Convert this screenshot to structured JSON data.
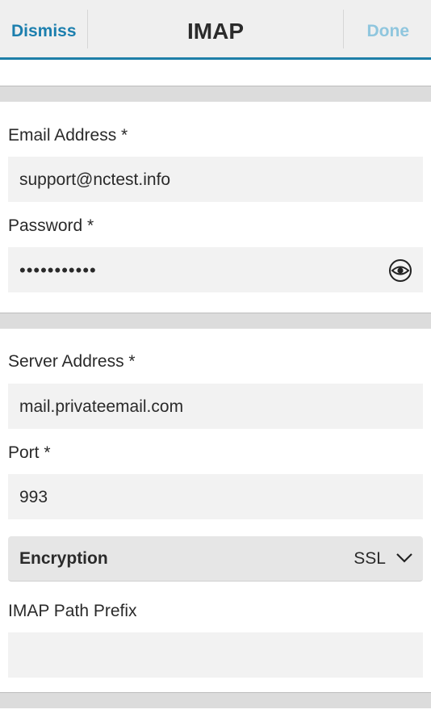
{
  "titlebar": {
    "dismiss_label": "Dismiss",
    "title": "IMAP",
    "done_label": "Done"
  },
  "account": {
    "email_label": "Email Address *",
    "email_value": "support@nctest.info",
    "password_label": "Password *",
    "password_value": "•••••••••••",
    "show_password_icon": "eye-icon"
  },
  "server": {
    "server_address_label": "Server Address *",
    "server_address_value": "mail.privateemail.com",
    "port_label": "Port *",
    "port_value": "993",
    "encryption_label": "Encryption",
    "encryption_value": "SSL",
    "encryption_icon": "chevron-down-icon",
    "path_prefix_label": "IMAP Path Prefix",
    "path_prefix_value": ""
  },
  "colors": {
    "accent": "#1c7fae",
    "done_disabled": "#8fc6de",
    "titlebar_underline": "#1e7fa8"
  }
}
